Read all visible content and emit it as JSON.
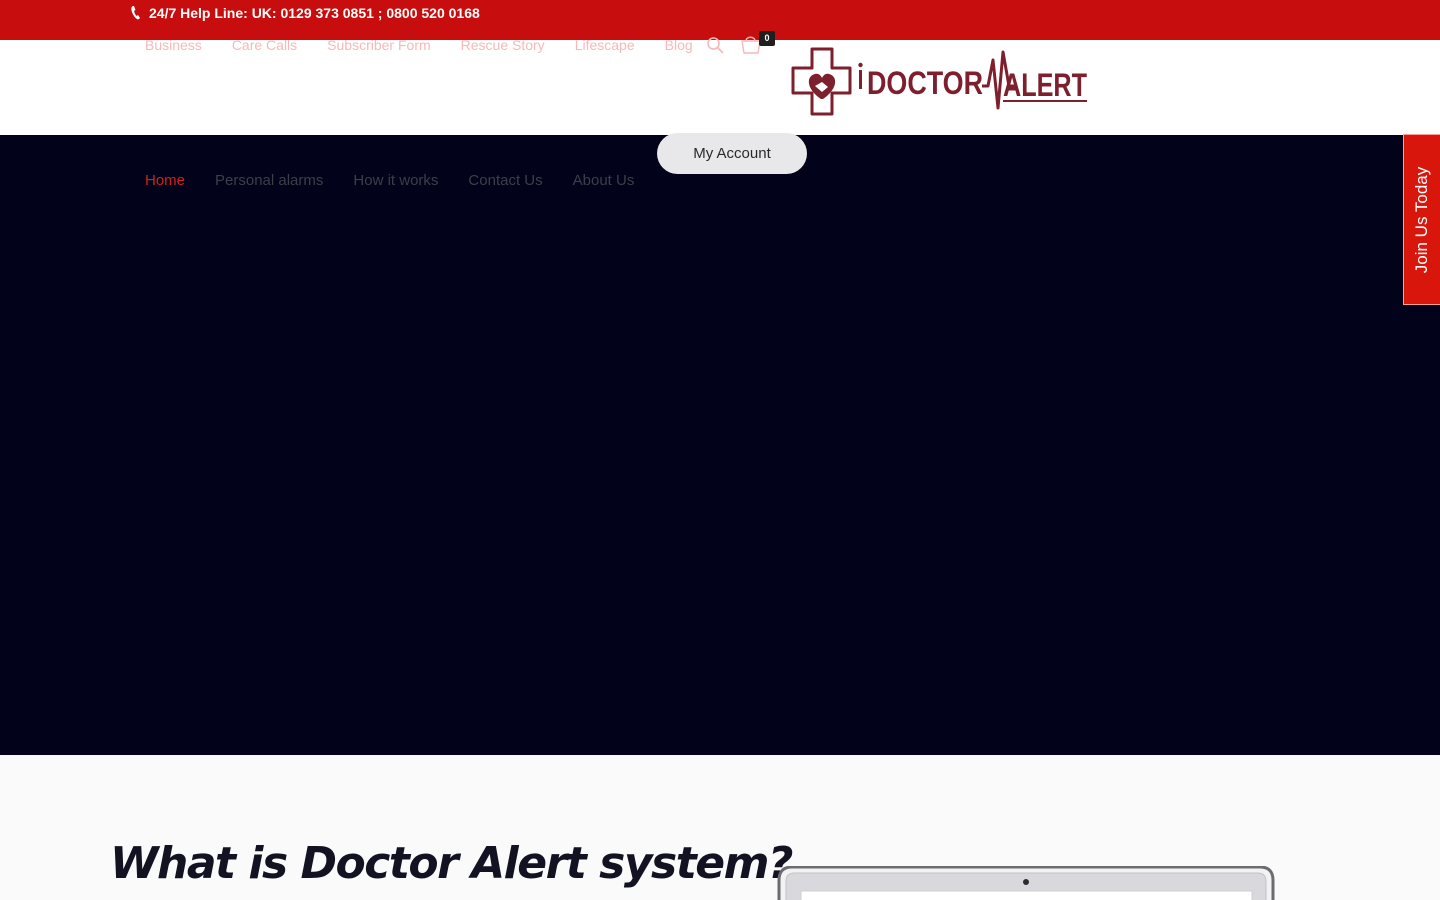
{
  "topbar": {
    "helpline": "24/7 Help Line: UK: 0129 373 0851 ; 0800 520 0168",
    "icon": "phone-icon"
  },
  "topnav": {
    "items": [
      "Business",
      "Care Calls",
      "Subscriber Form",
      "Rescue Story",
      "Lifescape",
      "Blog"
    ],
    "cart_count": "0"
  },
  "logo": {
    "text_left": "DOCTOR",
    "text_right": "ALERT"
  },
  "account": {
    "label": "My Account"
  },
  "mainnav": {
    "items": [
      "Home",
      "Personal alarms",
      "How it works",
      "Contact Us",
      "About Us"
    ],
    "active": "Home"
  },
  "join_tab": {
    "label": "Join Us Today"
  },
  "section": {
    "title": "What is Doctor Alert system?"
  },
  "colors": {
    "brand_red": "#c70d0d",
    "hero_bg": "#02021a",
    "logo_maroon": "#7d1f2c",
    "active_nav": "#d21f1f"
  }
}
